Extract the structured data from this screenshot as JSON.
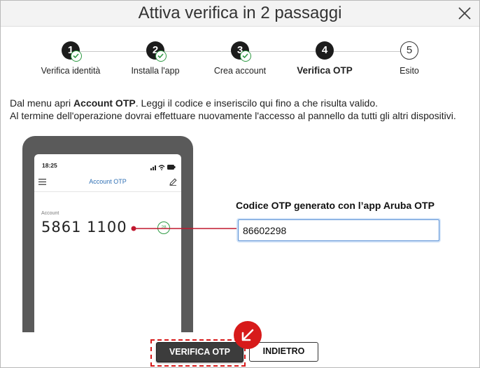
{
  "dialog": {
    "title": "Attiva verifica in 2 passaggi",
    "close_icon": "close-icon"
  },
  "stepper": {
    "steps": [
      {
        "number": "1",
        "label": "Verifica identità",
        "state": "completed"
      },
      {
        "number": "2",
        "label": "Installa l'app",
        "state": "completed"
      },
      {
        "number": "3",
        "label": "Crea account",
        "state": "completed"
      },
      {
        "number": "4",
        "label": "Verifica OTP",
        "state": "active"
      },
      {
        "number": "5",
        "label": "Esito",
        "state": "pending"
      }
    ]
  },
  "instructions": {
    "line1_prefix": "Dal menu apri ",
    "line1_bold": "Account OTP",
    "line1_suffix": ". Leggi il codice e inseriscilo qui fino a che risulta valido.",
    "line2": "Al termine dell'operazione dovrai effettuare nuovamente l'accesso al pannello da tutti gli altri dispositivi."
  },
  "phone": {
    "time": "18:25",
    "app_title": "Account OTP",
    "account_label": "Account",
    "otp_code": "5861 1100",
    "timer": "28"
  },
  "form": {
    "otp_label": "Codice OTP generato con l’app Aruba OTP",
    "otp_value": "86602298"
  },
  "buttons": {
    "verify": "VERIFICA OTP",
    "back": "INDIETRO"
  },
  "colors": {
    "accent_red": "#d71a1a",
    "check_green": "#2f9a44",
    "link_blue": "#2f6fb4"
  }
}
